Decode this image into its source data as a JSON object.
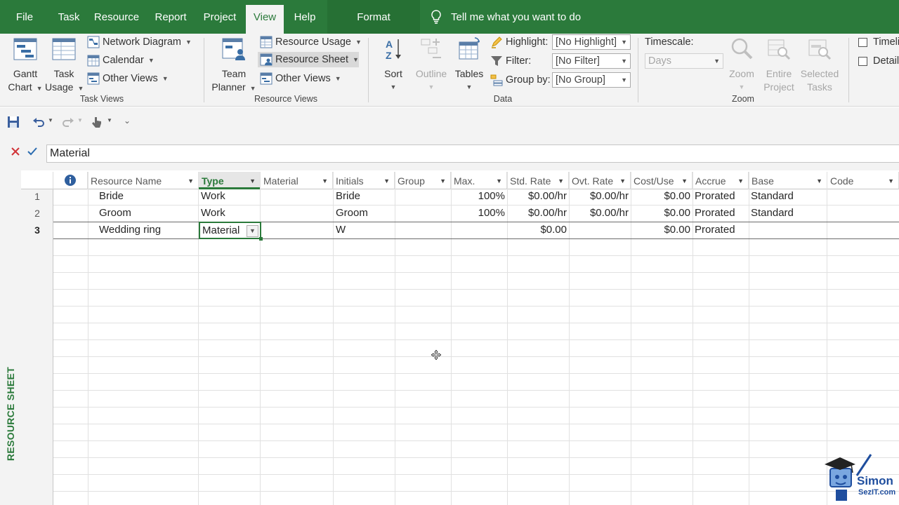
{
  "tabs": [
    {
      "label": "File"
    },
    {
      "label": "Task"
    },
    {
      "label": "Resource"
    },
    {
      "label": "Report"
    },
    {
      "label": "Project"
    },
    {
      "label": "View",
      "active": true
    },
    {
      "label": "Help"
    },
    {
      "label": "Format",
      "contextual": true
    }
  ],
  "tell_me": "Tell me what you want to do",
  "ribbon": {
    "task_views": {
      "group_label": "Task Views",
      "gantt_chart": {
        "line1": "Gantt",
        "line2": "Chart"
      },
      "task_usage": {
        "line1": "Task",
        "line2": "Usage"
      },
      "network_diagram": "Network Diagram",
      "calendar": "Calendar",
      "other_views": "Other Views"
    },
    "resource_views": {
      "group_label": "Resource Views",
      "team_planner": {
        "line1": "Team",
        "line2": "Planner"
      },
      "resource_usage": "Resource Usage",
      "resource_sheet": "Resource Sheet",
      "other_views": "Other Views"
    },
    "data": {
      "group_label": "Data",
      "sort": "Sort",
      "outline": "Outline",
      "tables": "Tables",
      "highlight_label": "Highlight:",
      "highlight_value": "[No Highlight]",
      "filter_label": "Filter:",
      "filter_value": "[No Filter]",
      "groupby_label": "Group by:",
      "groupby_value": "[No Group]"
    },
    "zoom": {
      "group_label": "Zoom",
      "timescale_label": "Timescale:",
      "timescale_value": "Days",
      "zoom": "Zoom",
      "entire_project": {
        "line1": "Entire",
        "line2": "Project"
      },
      "selected_tasks": {
        "line1": "Selected",
        "line2": "Tasks"
      }
    },
    "split_view": {
      "timeline": "Timeline",
      "details": "Details"
    }
  },
  "entry_bar": {
    "value": "Material"
  },
  "view_label": "RESOURCE SHEET",
  "table": {
    "columns": [
      "Resource Name",
      "Type",
      "Material",
      "Initials",
      "Group",
      "Max.",
      "Std. Rate",
      "Ovt. Rate",
      "Cost/Use",
      "Accrue",
      "Base",
      "Code"
    ],
    "rows": [
      {
        "num": "1",
        "name": "Bride",
        "type": "Work",
        "material": "",
        "initials": "Bride",
        "group": "",
        "max": "100%",
        "std_rate": "$0.00/hr",
        "ovt_rate": "$0.00/hr",
        "cost_use": "$0.00",
        "accrue": "Prorated",
        "base": "Standard",
        "code": ""
      },
      {
        "num": "2",
        "name": "Groom",
        "type": "Work",
        "material": "",
        "initials": "Groom",
        "group": "",
        "max": "100%",
        "std_rate": "$0.00/hr",
        "ovt_rate": "$0.00/hr",
        "cost_use": "$0.00",
        "accrue": "Prorated",
        "base": "Standard",
        "code": ""
      },
      {
        "num": "3",
        "name": "Wedding ring",
        "type": "Material",
        "material": "",
        "initials": "W",
        "group": "",
        "max": "",
        "std_rate": "$0.00",
        "ovt_rate": "",
        "cost_use": "$0.00",
        "accrue": "Prorated",
        "base": "",
        "code": ""
      }
    ]
  },
  "logo": {
    "line1": "Simon",
    "line2": "SezIT.com"
  },
  "colors": {
    "brand_green": "#2b7a3b",
    "ribbon_bg": "#f3f3f3"
  }
}
